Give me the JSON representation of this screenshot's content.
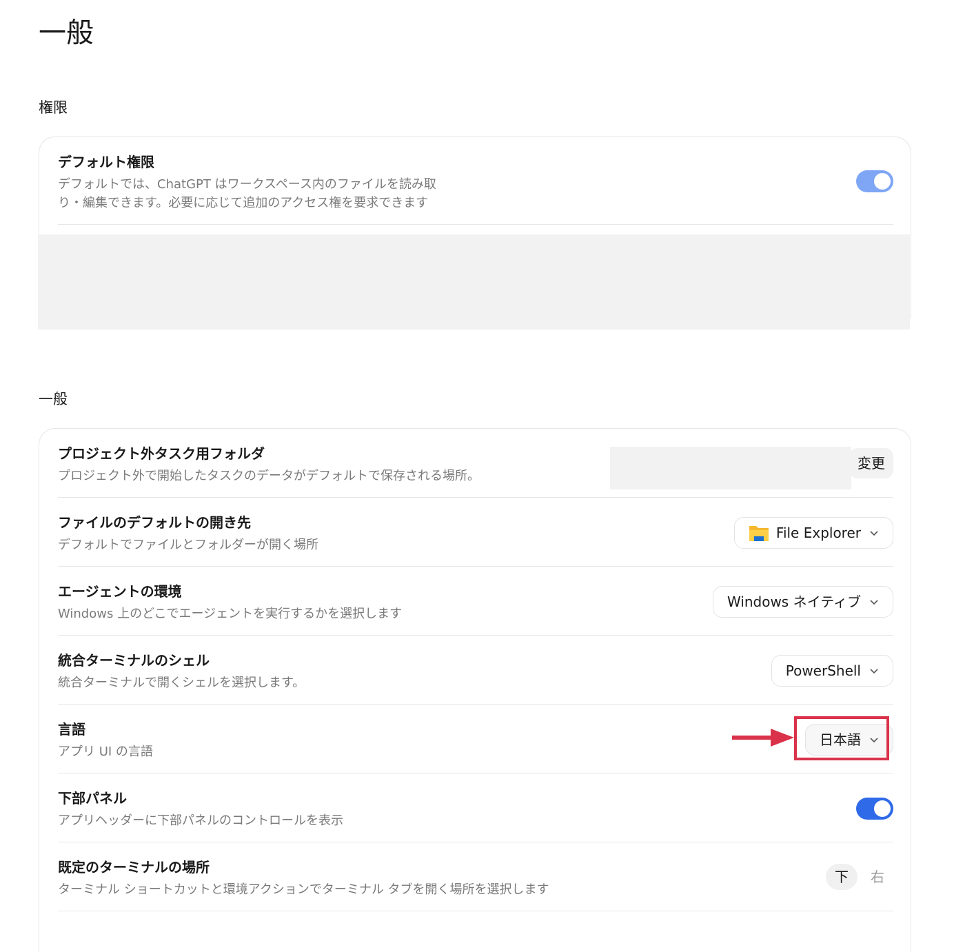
{
  "page": {
    "title": "一般"
  },
  "permissions_section": {
    "heading": "権限",
    "default_permission": {
      "title": "デフォルト権限",
      "desc_line1": "デフォルトでは、ChatGPT はワークスペース内のファイルを読み取",
      "desc_line2": "り・編集できます。必要に応じて追加のアクセス権を要求できます",
      "toggle_on": true
    }
  },
  "general_section": {
    "heading": "一般",
    "rows": {
      "task_folder": {
        "title": "プロジェクト外タスク用フォルダ",
        "desc": "プロジェクト外で開始したタスクのデータがデフォルトで保存される場所。",
        "button": "変更"
      },
      "open_with": {
        "title": "ファイルのデフォルトの開き先",
        "desc": "デフォルトでファイルとフォルダーが開く場所",
        "value": "File Explorer",
        "icon": "folder-icon"
      },
      "agent_env": {
        "title": "エージェントの環境",
        "desc": "Windows 上のどこでエージェントを実行するかを選択します",
        "value": "Windows ネイティブ"
      },
      "terminal_shell": {
        "title": "統合ターミナルのシェル",
        "desc": "統合ターミナルで開くシェルを選択します。",
        "value": "PowerShell"
      },
      "language": {
        "title": "言語",
        "desc": "アプリ UI の言語",
        "value": "日本語"
      },
      "bottom_panel": {
        "title": "下部パネル",
        "desc": "アプリヘッダーに下部パネルのコントロールを表示",
        "toggle_on": true
      },
      "terminal_location": {
        "title": "既定のターミナルの場所",
        "desc": "ターミナル ショートカットと環境アクションでターミナル タブを開く場所を選択します",
        "options": [
          "下",
          "右"
        ],
        "selected": "下"
      }
    }
  },
  "colors": {
    "accent": "#2f6ae8",
    "accent_light": "#7ea6f4",
    "annotation": "#d9324a"
  }
}
